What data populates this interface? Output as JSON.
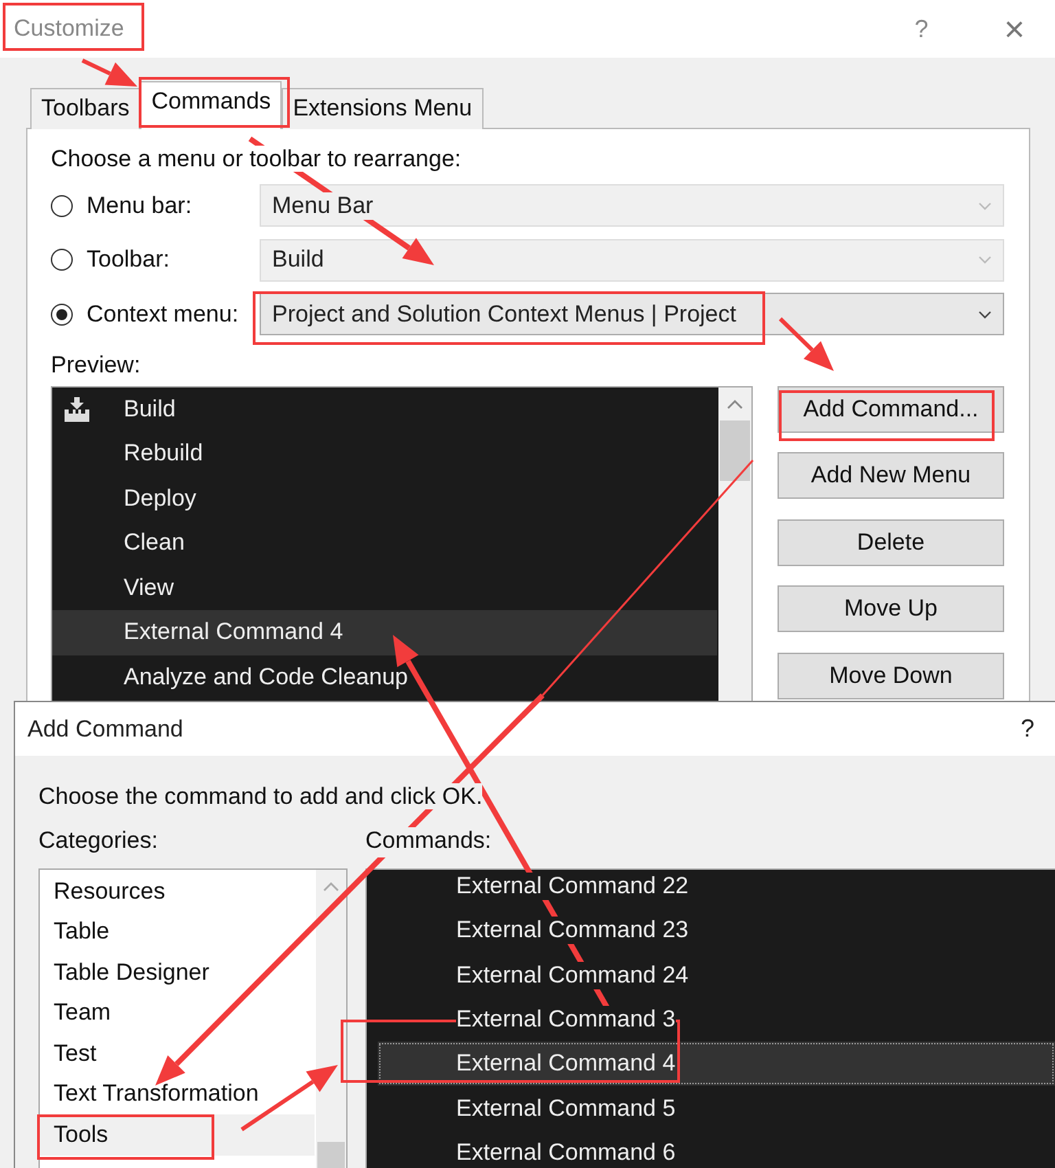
{
  "customize": {
    "title": "Customize",
    "help": "?",
    "close": "×",
    "tabs": [
      {
        "label": "Toolbars",
        "selected": false
      },
      {
        "label": "Commands",
        "selected": true
      },
      {
        "label": "Extensions Menu",
        "selected": false
      }
    ],
    "prompt": "Choose a menu or toolbar to rearrange:",
    "targets": [
      {
        "label": "Menu bar:",
        "selected": false,
        "value": "Menu Bar"
      },
      {
        "label": "Toolbar:",
        "selected": false,
        "value": "Build"
      },
      {
        "label": "Context menu:",
        "selected": true,
        "value": "Project and Solution Context Menus | Project"
      }
    ],
    "preview_label": "Preview:",
    "preview_items": [
      {
        "label": "Build",
        "kind": "icon",
        "selected": false
      },
      {
        "label": "Rebuild",
        "kind": "plain",
        "selected": false
      },
      {
        "label": "Deploy",
        "kind": "plain",
        "selected": false
      },
      {
        "label": "Clean",
        "kind": "plain",
        "selected": false
      },
      {
        "label": "View",
        "kind": "plain",
        "selected": false
      },
      {
        "label": "External Command 4",
        "kind": "plain",
        "selected": true
      },
      {
        "label": "Analyze and Code Cleanup",
        "kind": "plain",
        "selected": false
      }
    ],
    "buttons": [
      "Add Command...",
      "Add New Menu",
      "Delete",
      "Move Up",
      "Move Down"
    ]
  },
  "add_command": {
    "title": "Add Command",
    "help": "?",
    "prompt": "Choose the command to add and click OK.",
    "categories_label": "Categories:",
    "commands_label": "Commands:",
    "categories": [
      {
        "label": "Resources",
        "selected": false
      },
      {
        "label": "Table",
        "selected": false
      },
      {
        "label": "Table Designer",
        "selected": false
      },
      {
        "label": "Team",
        "selected": false
      },
      {
        "label": "Test",
        "selected": false
      },
      {
        "label": "Text Transformation",
        "selected": false
      },
      {
        "label": "Tools",
        "selected": true
      }
    ],
    "commands": [
      {
        "label": "External Command 22",
        "selected": false
      },
      {
        "label": "External Command 23",
        "selected": false
      },
      {
        "label": "External Command 24",
        "selected": false
      },
      {
        "label": "External Command 3",
        "selected": false
      },
      {
        "label": "External Command 4",
        "selected": true
      },
      {
        "label": "External Command 5",
        "selected": false
      },
      {
        "label": "External Command 6",
        "selected": false
      }
    ]
  }
}
